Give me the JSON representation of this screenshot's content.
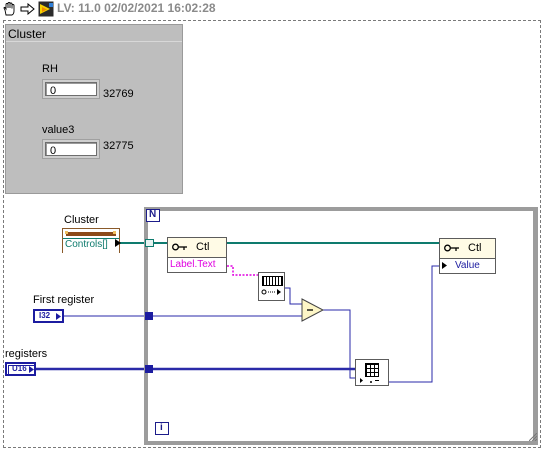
{
  "toolbar": {
    "version_text": "LV: 11.0 02/02/2021 16:02:28",
    "icons": [
      "hand-icon",
      "arrow-icon",
      "labview-vi-icon"
    ]
  },
  "cluster_panel": {
    "title": "Cluster",
    "fields": [
      {
        "label": "RH",
        "value": "0",
        "reference": "32769"
      },
      {
        "label": "value3",
        "value": "0",
        "reference": "32775"
      }
    ]
  },
  "diagram": {
    "cluster_terminal": {
      "label": "Cluster",
      "property": "Controls[]"
    },
    "first_register": {
      "label": "First register",
      "type": "I32"
    },
    "registers": {
      "label": "registers",
      "type": "U16"
    },
    "loop_count_label": "N",
    "loop_index_label": "i",
    "property_node_1": {
      "class": "Ctl",
      "property": "Label.Text"
    },
    "property_node_2": {
      "class": "Ctl",
      "property": "Value"
    },
    "tunnel_glyph": "[]"
  },
  "colors": {
    "panel_bg": "#bebebe",
    "wire_ref": "#0e7b6e",
    "wire_int": "#2a2aa8",
    "wire_string": "#e000e0"
  }
}
